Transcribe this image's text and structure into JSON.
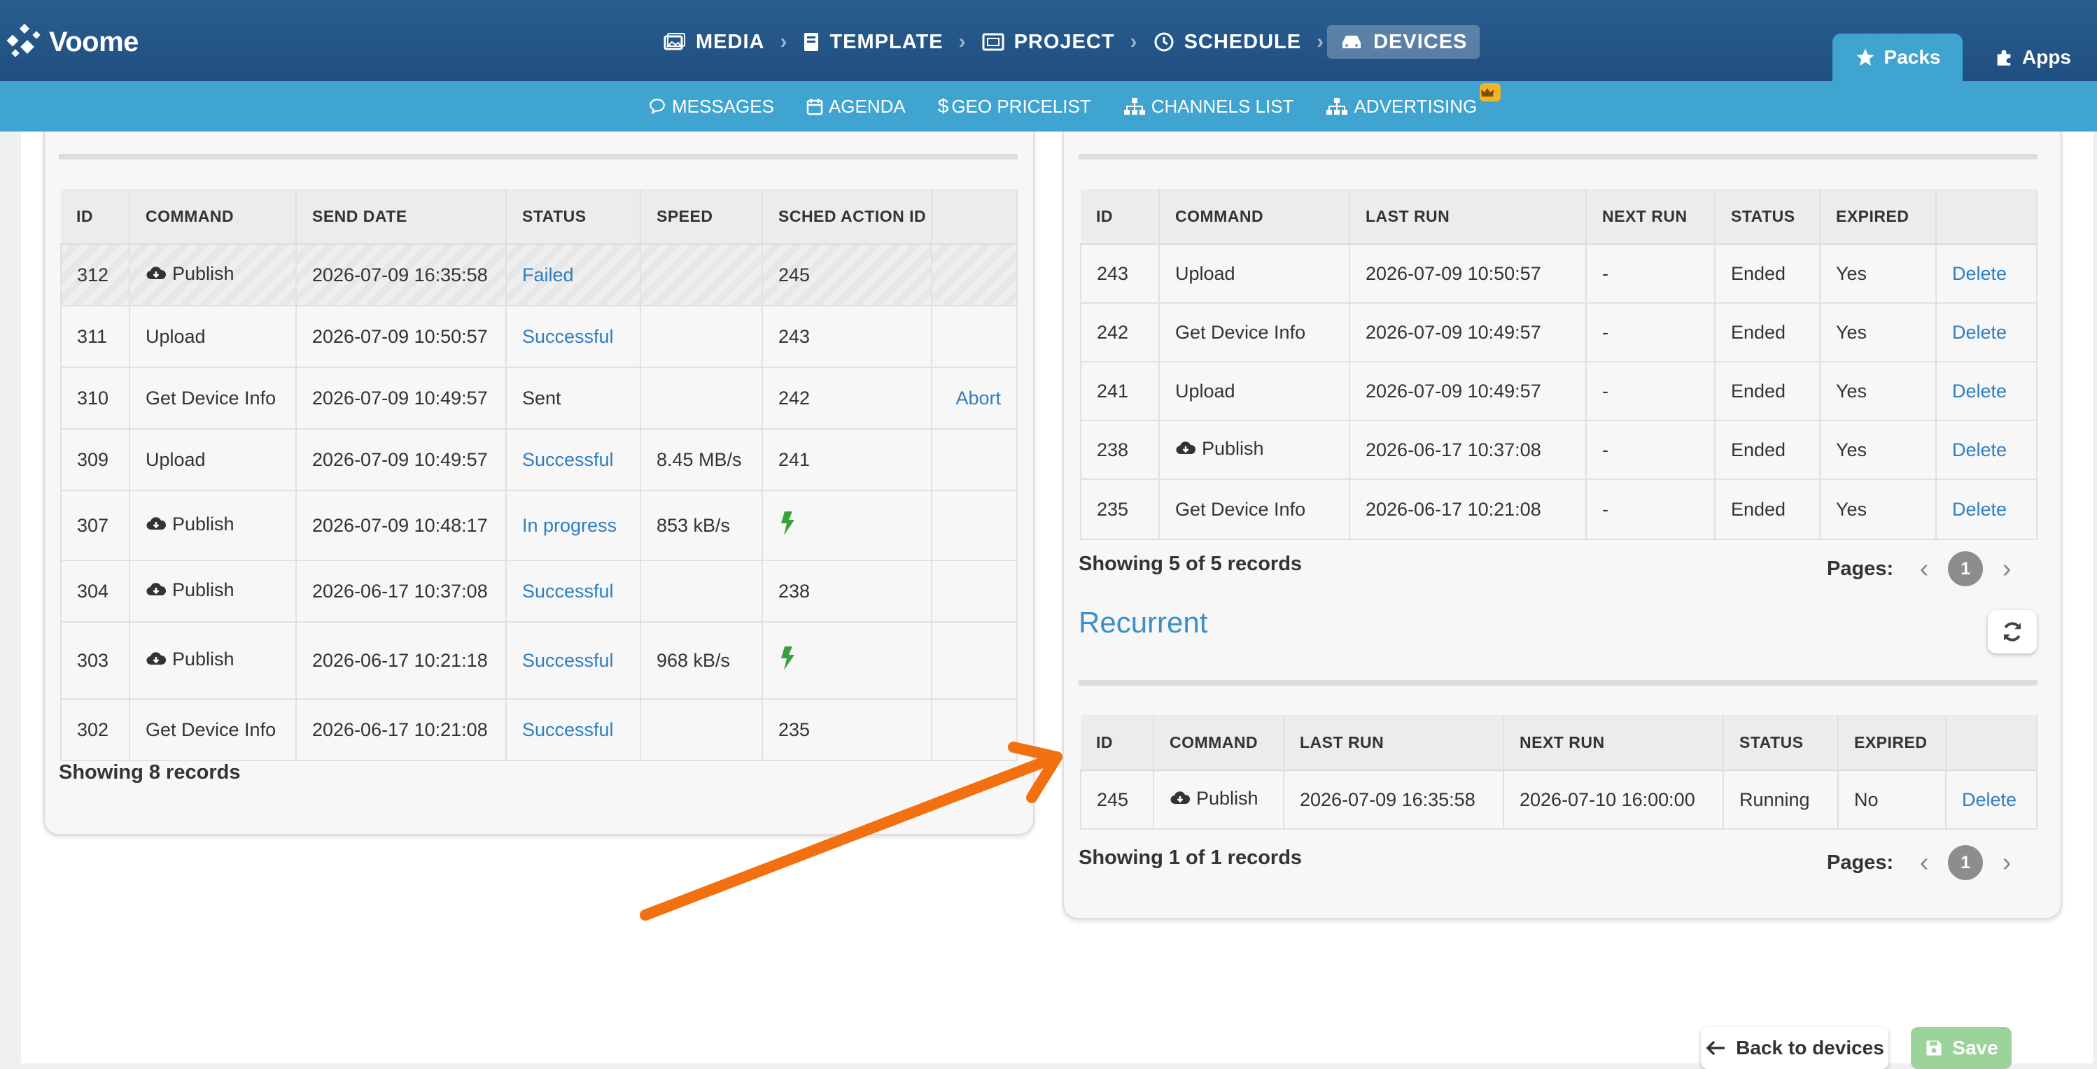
{
  "app": {
    "logo_text": "Voome"
  },
  "breadcrumb": [
    {
      "label": "MEDIA",
      "icon": "image-icon"
    },
    {
      "label": "TEMPLATE",
      "icon": "book-icon"
    },
    {
      "label": "PROJECT",
      "icon": "project-icon"
    },
    {
      "label": "SCHEDULE",
      "icon": "clock-icon"
    },
    {
      "label": "DEVICES",
      "icon": "devices-icon",
      "active": true
    }
  ],
  "top_tabs": {
    "packs": "Packs",
    "apps": "Apps"
  },
  "subnav": {
    "messages": "MESSAGES",
    "agenda": "AGENDA",
    "geo_pricelist": "GEO PRICELIST",
    "channels_list": "CHANNELS LIST",
    "advertising": "ADVERTISING"
  },
  "commands_table": {
    "headers": [
      "ID",
      "COMMAND",
      "SEND DATE",
      "STATUS",
      "SPEED",
      "SCHED ACTION ID",
      ""
    ],
    "rows": [
      {
        "id": "312",
        "command": "Publish",
        "cloud": true,
        "send_date": "2026-07-09 16:35:58",
        "status": "Failed",
        "status_link": true,
        "speed": "",
        "sched": "245",
        "action": ""
      },
      {
        "id": "311",
        "command": "Upload",
        "cloud": false,
        "send_date": "2026-07-09 10:50:57",
        "status": "Successful",
        "status_link": true,
        "speed": "",
        "sched": "243",
        "action": ""
      },
      {
        "id": "310",
        "command": "Get Device Info",
        "cloud": false,
        "send_date": "2026-07-09 10:49:57",
        "status": "Sent",
        "status_link": false,
        "speed": "",
        "sched": "242",
        "action": "Abort"
      },
      {
        "id": "309",
        "command": "Upload",
        "cloud": false,
        "send_date": "2026-07-09 10:49:57",
        "status": "Successful",
        "status_link": true,
        "speed": "8.45 MB/s",
        "sched": "241",
        "action": ""
      },
      {
        "id": "307",
        "command": "Publish",
        "cloud": true,
        "send_date": "2026-07-09 10:48:17",
        "status": "In progress",
        "status_link": true,
        "speed": "853 kB/s",
        "sched": "",
        "bolt": true,
        "action": ""
      },
      {
        "id": "304",
        "command": "Publish",
        "cloud": true,
        "send_date": "2026-06-17 10:37:08",
        "status": "Successful",
        "status_link": true,
        "speed": "",
        "sched": "238",
        "action": ""
      },
      {
        "id": "303",
        "command": "Publish",
        "cloud": true,
        "send_date": "2026-06-17 10:21:18",
        "status": "Successful",
        "status_link": true,
        "speed": "968 kB/s",
        "sched": "",
        "bolt": true,
        "action": ""
      },
      {
        "id": "302",
        "command": "Get Device Info",
        "cloud": false,
        "send_date": "2026-06-17 10:21:08",
        "status": "Successful",
        "status_link": true,
        "speed": "",
        "sched": "235",
        "action": ""
      }
    ],
    "records_text": "Showing 8 records"
  },
  "scheduled_table": {
    "headers": [
      "ID",
      "COMMAND",
      "LAST RUN",
      "NEXT RUN",
      "STATUS",
      "EXPIRED",
      ""
    ],
    "rows": [
      {
        "id": "243",
        "command": "Upload",
        "cloud": false,
        "last_run": "2026-07-09 10:50:57",
        "next_run": "-",
        "status": "Ended",
        "expired": "Yes",
        "action": "Delete"
      },
      {
        "id": "242",
        "command": "Get Device Info",
        "cloud": false,
        "last_run": "2026-07-09 10:49:57",
        "next_run": "-",
        "status": "Ended",
        "expired": "Yes",
        "action": "Delete"
      },
      {
        "id": "241",
        "command": "Upload",
        "cloud": false,
        "last_run": "2026-07-09 10:49:57",
        "next_run": "-",
        "status": "Ended",
        "expired": "Yes",
        "action": "Delete"
      },
      {
        "id": "238",
        "command": "Publish",
        "cloud": true,
        "last_run": "2026-06-17 10:37:08",
        "next_run": "-",
        "status": "Ended",
        "expired": "Yes",
        "action": "Delete"
      },
      {
        "id": "235",
        "command": "Get Device Info",
        "cloud": false,
        "last_run": "2026-06-17 10:21:08",
        "next_run": "-",
        "status": "Ended",
        "expired": "Yes",
        "action": "Delete"
      }
    ],
    "records_text": "Showing 5 of 5 records",
    "pages_label": "Pages:",
    "page": "1"
  },
  "recurrent": {
    "title": "Recurrent",
    "headers": [
      "ID",
      "COMMAND",
      "LAST RUN",
      "NEXT RUN",
      "STATUS",
      "EXPIRED",
      ""
    ],
    "rows": [
      {
        "id": "245",
        "command": "Publish",
        "cloud": true,
        "last_run": "2026-07-09 16:35:58",
        "next_run": "2026-07-10 16:00:00",
        "status": "Running",
        "expired": "No",
        "action": "Delete"
      }
    ],
    "records_text": "Showing 1 of 1 records",
    "pages_label": "Pages:",
    "page": "1"
  },
  "footer": {
    "back_label": "Back to devices",
    "save_label": "Save"
  },
  "colors": {
    "link": "#2f7ec2",
    "topbar": "#1f4f80",
    "subbar": "#3fa4cf",
    "bolt": "#3aa13a",
    "arrow": "#f27010",
    "save": "#9bd39a"
  }
}
